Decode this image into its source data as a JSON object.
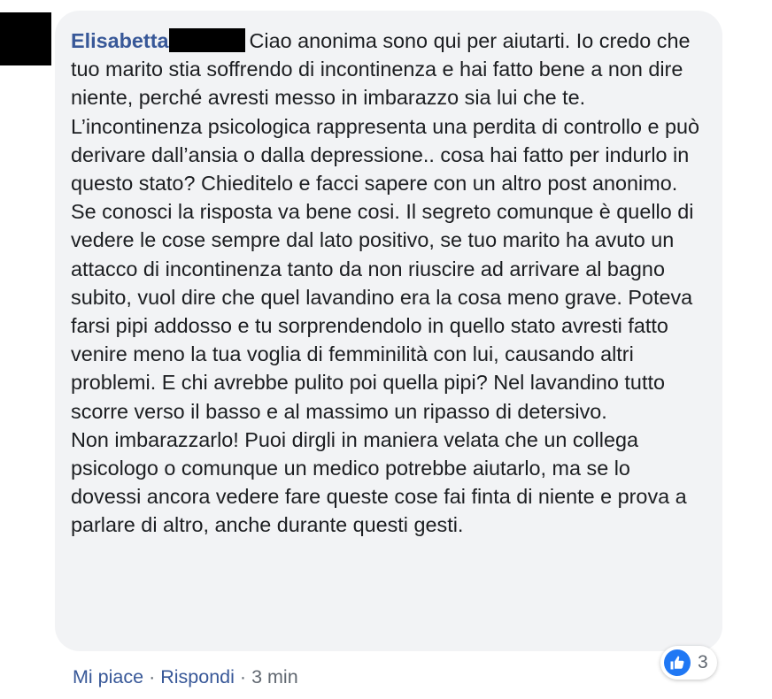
{
  "comment": {
    "author": "Elisabetta",
    "text": "Ciao anonima sono qui per aiutarti. Io credo che tuo marito stia soffrendo di incontinenza e hai fatto bene a non dire niente, perché avresti messo in imbarazzo sia lui che te. L’incontinenza psicologica rappresenta una perdita di controllo e può derivare dall’ansia o dalla depressione.. cosa hai fatto per indurlo in questo stato? Chieditelo e facci sapere con un altro post anonimo. Se conosci la risposta va bene cosi. Il segreto comunque è quello di vedere le cose sempre dal lato positivo, se tuo marito ha avuto un attacco di incontinenza tanto da non riuscire ad arrivare al bagno subito, vuol dire che quel lavandino era la cosa meno grave. Poteva farsi pipi addosso e tu sorprendendolo in quello stato avresti fatto venire meno la tua voglia di femminilità con lui, causando altri problemi. E chi avrebbe pulito poi quella pipi? Nel lavandino tutto scorre verso il basso e al massimo un ripasso di detersivo.\nNon imbarazzarlo! Puoi dirgli in maniera velata che un collega psicologo o comunque un medico potrebbe aiutarlo, ma se lo dovessi ancora vedere fare queste cose fai finta di niente e prova a parlare di altro, anche durante questi gesti."
  },
  "reactions": {
    "icon": "thumbs-up-icon",
    "count": "3"
  },
  "actions": {
    "like": "Mi piace",
    "reply": "Rispondi",
    "separator": "·",
    "time": "3 min"
  },
  "colors": {
    "link": "#385898",
    "bubble": "#f2f3f5",
    "text": "#1c1e21",
    "meta": "#606770",
    "like_blue": "#2078f4"
  }
}
